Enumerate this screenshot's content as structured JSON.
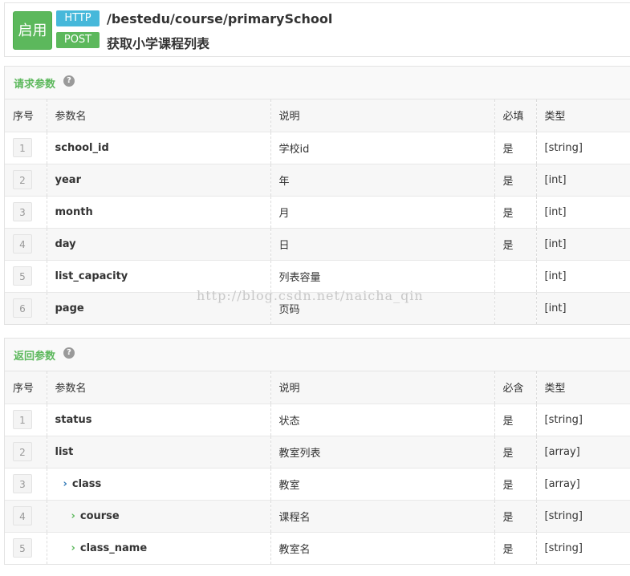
{
  "header": {
    "status": "启用",
    "http_tag": "HTTP",
    "method_tag": "POST",
    "path": "/bestedu/course/primarySchool",
    "title": "获取小学课程列表"
  },
  "request": {
    "title": "请求参数",
    "help": "?",
    "columns": [
      "序号",
      "参数名",
      "说明",
      "必填",
      "类型"
    ],
    "rows": [
      {
        "no": "1",
        "name": "school_id",
        "desc": "学校id",
        "req": "是",
        "type": "[string]"
      },
      {
        "no": "2",
        "name": "year",
        "desc": "年",
        "req": "是",
        "type": "[int]"
      },
      {
        "no": "3",
        "name": "month",
        "desc": "月",
        "req": "是",
        "type": "[int]"
      },
      {
        "no": "4",
        "name": "day",
        "desc": "日",
        "req": "是",
        "type": "[int]"
      },
      {
        "no": "5",
        "name": "list_capacity",
        "desc": "列表容量",
        "req": "",
        "type": "[int]"
      },
      {
        "no": "6",
        "name": "page",
        "desc": "页码",
        "req": "",
        "type": "[int]"
      }
    ]
  },
  "response": {
    "title": "返回参数",
    "help": "?",
    "columns": [
      "序号",
      "参数名",
      "说明",
      "必含",
      "类型"
    ],
    "rows": [
      {
        "no": "1",
        "name": "status",
        "desc": "状态",
        "req": "是",
        "type": "[string]"
      },
      {
        "no": "2",
        "name": "list",
        "desc": "教室列表",
        "req": "是",
        "type": "[array]"
      },
      {
        "no": "3",
        "name": "class",
        "desc": "教室",
        "req": "是",
        "type": "[array]",
        "chevron": "›"
      },
      {
        "no": "4",
        "name": "course",
        "desc": "课程名",
        "req": "是",
        "type": "[string]",
        "chevron": "›"
      },
      {
        "no": "5",
        "name": "class_name",
        "desc": "教室名",
        "req": "是",
        "type": "[string]",
        "chevron": "›"
      }
    ]
  },
  "watermark": "http://blog.csdn.net/naicha_qin",
  "colors": {
    "green": "#5cb85c",
    "blue": "#46b8da",
    "chevron_blue": "#337ab7"
  }
}
